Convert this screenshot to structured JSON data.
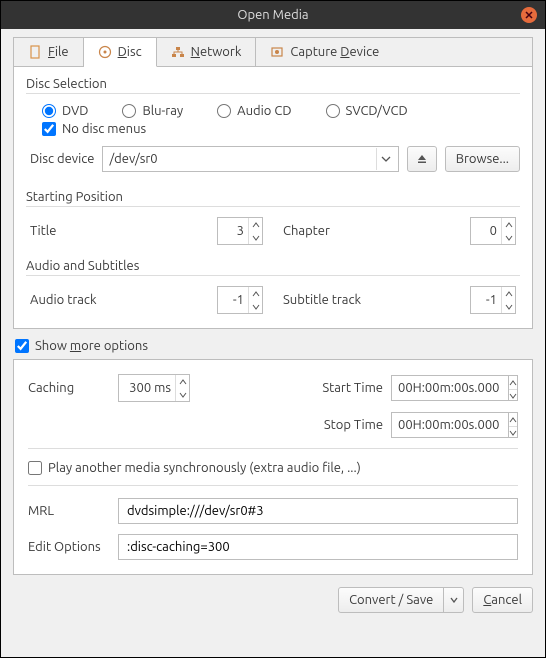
{
  "window": {
    "title": "Open Media"
  },
  "tabs": {
    "file": "File",
    "disc": "Disc",
    "network": "Network",
    "capture": "Capture Device"
  },
  "disc": {
    "selection_title": "Disc Selection",
    "radio": {
      "dvd": "DVD",
      "bluray": "Blu-ray",
      "audiocd": "Audio CD",
      "svcd": "SVCD/VCD"
    },
    "no_menus": "No disc menus",
    "device_label": "Disc device",
    "device_value": "/dev/sr0",
    "browse": "Browse..."
  },
  "startpos": {
    "title": "Starting Position",
    "title_label": "Title",
    "title_value": "3",
    "chapter_label": "Chapter",
    "chapter_value": "0"
  },
  "audiosub": {
    "title": "Audio and Subtitles",
    "audio_label": "Audio track",
    "audio_value": "-1",
    "sub_label": "Subtitle track",
    "sub_value": "-1"
  },
  "show_more": "Show more options",
  "more": {
    "caching_label": "Caching",
    "caching_value": "300 ms",
    "start_label": "Start Time",
    "start_value": "00H:00m:00s.000",
    "stop_label": "Stop Time",
    "stop_value": "00H:00m:00s.000",
    "sync_label": "Play another media synchronously (extra audio file, ...)",
    "mrl_label": "MRL",
    "mrl_value": "dvdsimple:///dev/sr0#3",
    "edit_label": "Edit Options",
    "edit_value": ":disc-caching=300"
  },
  "buttons": {
    "convert": "Convert / Save",
    "cancel": "Cancel"
  }
}
